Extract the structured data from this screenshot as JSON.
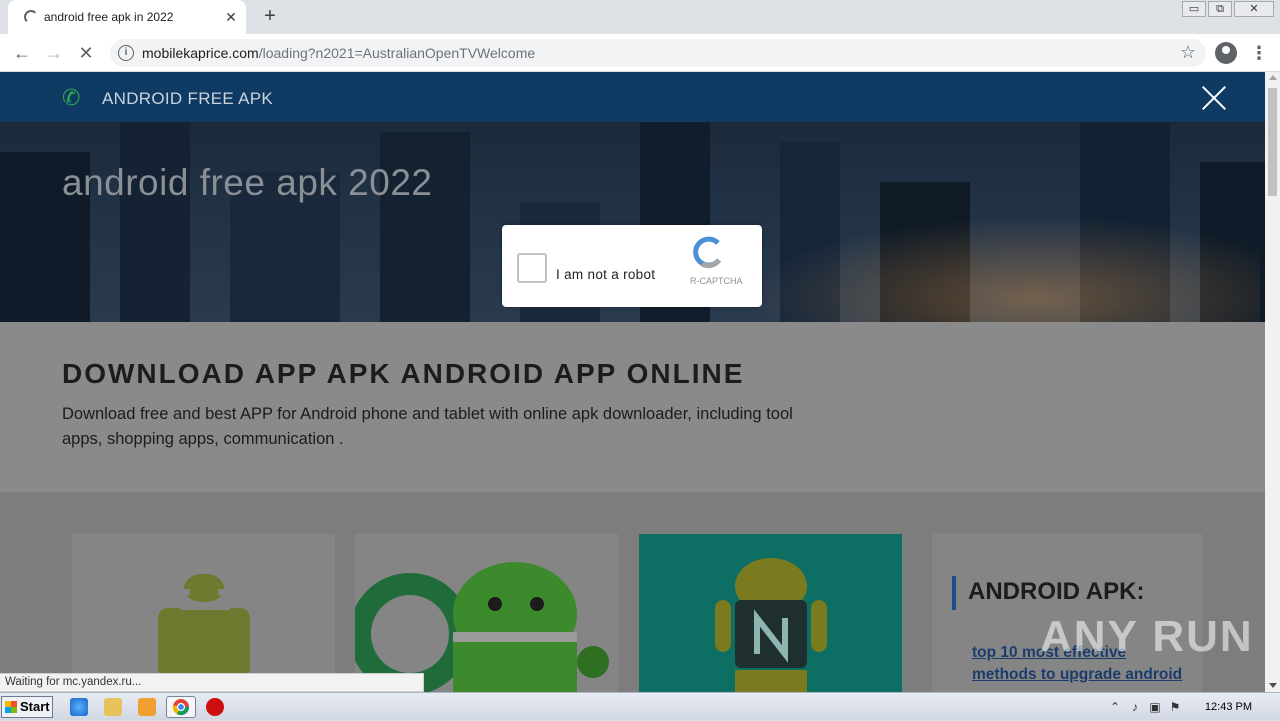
{
  "tab": {
    "title": "android free apk in 2022",
    "close_label": "✕",
    "new_tab_label": "+"
  },
  "window": {
    "minimize": "▭",
    "restore": "⧉",
    "close": "✕"
  },
  "toolbar": {
    "back": "←",
    "forward": "→",
    "stop": "✕",
    "url_host": "mobilekaprice.com",
    "url_path": "/loading?n2021=AustralianOpenTVWelcome",
    "info_icon": "i",
    "bookmark_star": "☆",
    "menu": "⋮"
  },
  "site": {
    "brand": "ANDROID FREE APK",
    "hero_title": "android free apk 2022",
    "heading": "DOWNLOAD APP APK ANDROID APP ONLINE",
    "description": "Download free and best APP for Android phone and tablet with online apk downloader, including tool apps, shopping apps, communication .",
    "sidebar_title": "ANDROID APK:",
    "sidebar_link": "top 10 most effective methods to upgrade android"
  },
  "captcha": {
    "label": "I am not a robot",
    "brand": "R-CAPTCHA"
  },
  "status_text": "Waiting for mc.yandex.ru...",
  "watermark": "ANY RUN",
  "taskbar": {
    "start_label": "Start",
    "clock": "12:43 PM"
  },
  "colors": {
    "header_bg": "#0e3a63",
    "brand_green": "#2fa84f",
    "teal_card": "#0d6e64",
    "link": "#1a3d6e"
  }
}
